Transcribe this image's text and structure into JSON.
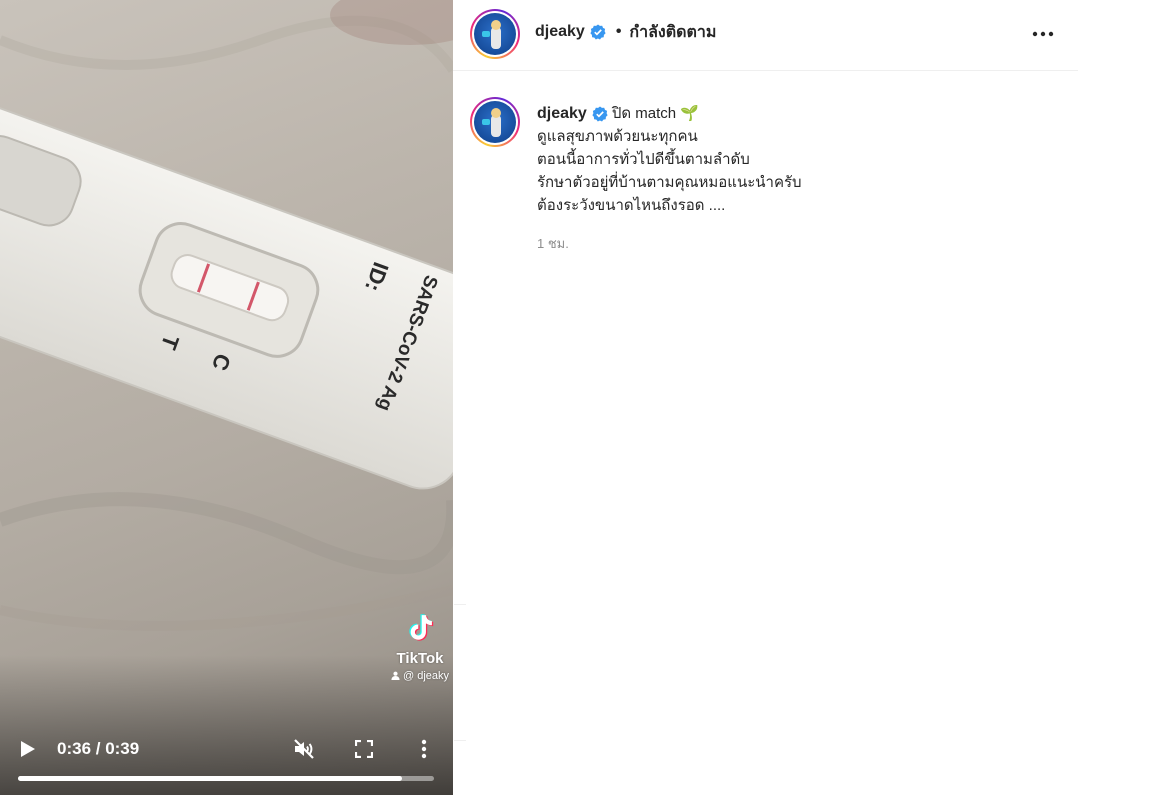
{
  "video": {
    "watermark": {
      "brand": "TikTok",
      "handle": "@ djeaky"
    },
    "controls": {
      "time": "0:36 / 0:39",
      "progress": 0.923,
      "play_icon": "play-icon",
      "mute_icon": "muted-speaker-icon",
      "fullscreen_icon": "fullscreen-icon",
      "more_icon": "vertical-more-icon"
    }
  },
  "post": {
    "header": {
      "username": "djeaky",
      "separator": "•",
      "follow_status": "กำลังติดตาม",
      "more_icon": "horizontal-more-icon"
    },
    "caption": {
      "username": "djeaky",
      "first_line": "ปิด match 🌱",
      "lines": [
        "ดูแลสุขภาพด้วยนะทุกคน",
        "ตอนนี้อาการทั่วไปดีขึ้นตามลำดับ",
        "รักษาตัวอยู่ที่บ้านตามคุณหมอแนะนำครับ",
        "ต้องระวังขนาดไหนถึงรอด ...."
      ],
      "time": "1 ชม."
    }
  },
  "colors": {
    "verified_blue": "#3897f0",
    "text_primary": "#262626",
    "text_secondary": "#8e8e8e"
  }
}
